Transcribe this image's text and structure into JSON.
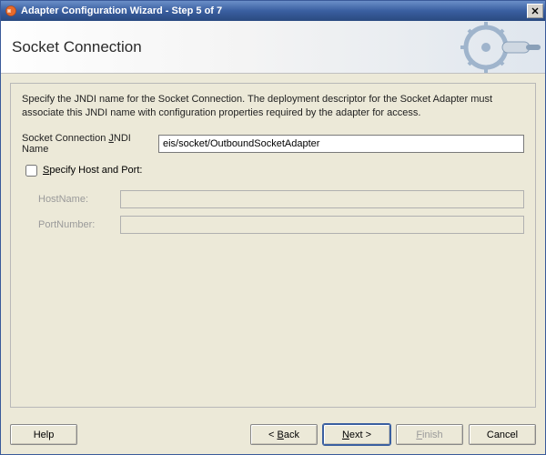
{
  "window": {
    "title": "Adapter Configuration Wizard - Step 5 of 7"
  },
  "header": {
    "title": "Socket Connection"
  },
  "content": {
    "description": "Specify the JNDI name for the Socket Connection.  The deployment descriptor for the Socket Adapter must associate this JNDI name with configuration properties required by the adapter for access.",
    "jndi_label_pre": "Socket Connection ",
    "jndi_label_mn": "J",
    "jndi_label_post": "NDI Name",
    "jndi_value": "eis/socket/OutboundSocketAdapter",
    "checkbox_label_mn": "S",
    "checkbox_label_post": "pecify Host and Port:",
    "checkbox_checked": false,
    "host_label": "HostName:",
    "host_value": "",
    "port_label": "PortNumber:",
    "port_value": ""
  },
  "buttons": {
    "help": "Help",
    "back_pre": "< ",
    "back_mn": "B",
    "back_post": "ack",
    "next_mn": "N",
    "next_post": "ext >",
    "finish_mn": "F",
    "finish_post": "inish",
    "cancel": "Cancel"
  },
  "colors": {
    "accent": "#3a5fa0"
  }
}
